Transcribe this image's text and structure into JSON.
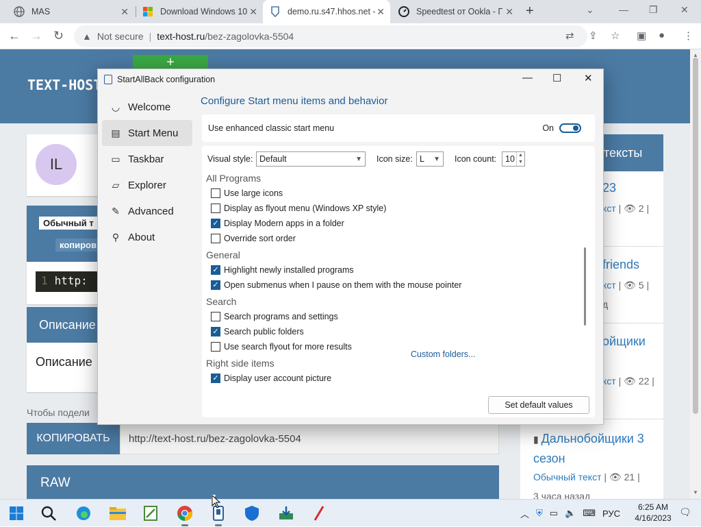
{
  "browser": {
    "tabs": [
      {
        "label": "MAS",
        "icon": "globe-icon"
      },
      {
        "label": "Download Windows 10",
        "icon": "windows-logo-icon"
      },
      {
        "label": "demo.ru.s47.hhos.net -",
        "icon": "shield-logo-icon"
      },
      {
        "label": "Speedtest от Ookla - Г",
        "icon": "speedtest-icon"
      }
    ],
    "security": "Not secure",
    "url_host": "text-host.ru",
    "url_path": "/bez-zagolovka-5504"
  },
  "site": {
    "logo": "TEXT-HOST",
    "green_btn": "+",
    "avatar": "IL",
    "label_text": "Обычный т",
    "copy_short": "копиров",
    "code_line_no": "1",
    "code": "http:",
    "desc_bar": "Описание",
    "desc_text": "Описание",
    "share_text": "Чтобы подели",
    "copy_button": "КОПИРОВАТЬ",
    "copy_url": "http://text-host.ru/bez-zagolovka-5504",
    "raw": "RAW",
    "right_header": "тексты",
    "cards": [
      {
        "title": "23",
        "meta_type": "кст",
        "views": "2",
        "time": ""
      },
      {
        "title": "friends",
        "meta_type": "кст",
        "views": "5",
        "time": "д"
      },
      {
        "title": "ойщики",
        "meta_type": "кст",
        "views": "22",
        "time": ""
      },
      {
        "title": "Дальнобойщики 3 сезон",
        "meta_type": "Обычный текст",
        "views": "21",
        "time": "3 часа назад"
      }
    ]
  },
  "dialog": {
    "title": "StartAllBack configuration",
    "nav": [
      {
        "label": "Welcome",
        "icon": "smile-icon"
      },
      {
        "label": "Start Menu",
        "icon": "start-menu-icon"
      },
      {
        "label": "Taskbar",
        "icon": "taskbar-icon"
      },
      {
        "label": "Explorer",
        "icon": "folder-icon"
      },
      {
        "label": "Advanced",
        "icon": "wrench-icon"
      },
      {
        "label": "About",
        "icon": "about-icon"
      }
    ],
    "heading": "Configure Start menu items and behavior",
    "enhanced_label": "Use enhanced classic start menu",
    "enhanced_state": "On",
    "visual_style_label": "Visual style:",
    "visual_style_value": "Default",
    "icon_size_label": "Icon size:",
    "icon_size_value": "L",
    "icon_count_label": "Icon count:",
    "icon_count_value": "10",
    "groups": {
      "all_programs": "All Programs",
      "general": "General",
      "search": "Search",
      "right_side": "Right side items"
    },
    "options": [
      {
        "label": "Use large icons",
        "checked": false
      },
      {
        "label": "Display as flyout menu (Windows XP style)",
        "checked": false
      },
      {
        "label": "Display Modern apps in a folder",
        "checked": true
      },
      {
        "label": "Override sort order",
        "checked": false
      },
      {
        "label": "Highlight newly installed programs",
        "checked": true
      },
      {
        "label": "Open submenus when I pause on them with the mouse pointer",
        "checked": true
      },
      {
        "label": "Search programs and settings",
        "checked": false
      },
      {
        "label": "Search public folders",
        "checked": true
      },
      {
        "label": "Use search flyout for more results",
        "checked": false
      },
      {
        "label": "Display user account picture",
        "checked": true
      }
    ],
    "custom_folders": "Custom folders...",
    "default_button": "Set default values"
  },
  "taskbar": {
    "language": "РУС",
    "time": "6:25 AM",
    "date": "4/16/2023"
  }
}
